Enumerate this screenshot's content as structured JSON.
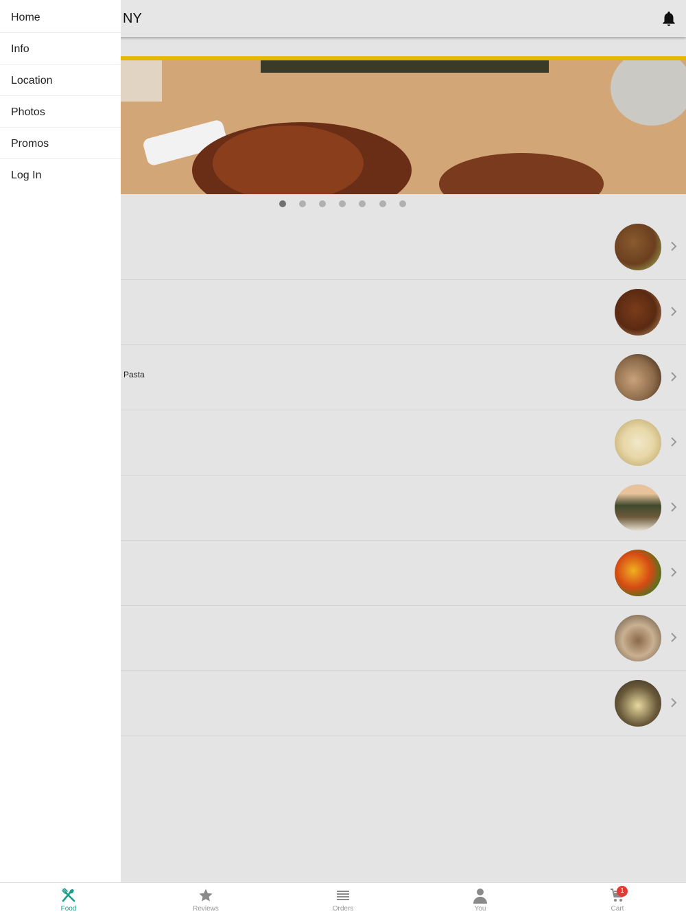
{
  "header": {
    "title": "NY",
    "bell_icon": "bell-icon"
  },
  "carousel": {
    "dot_count": 7,
    "active_index": 0
  },
  "menu": {
    "items": [
      {
        "label": "",
        "thumb_colors": [
          "#6b3f1f",
          "#8a5a2f",
          "#a8c060"
        ]
      },
      {
        "label": "",
        "thumb_colors": [
          "#5a2a12",
          "#7b3c1a",
          "#c9a070"
        ]
      },
      {
        "label": "e Pasta",
        "thumb_colors": [
          "#c9a27a",
          "#8c6a4a",
          "#2b1a10"
        ]
      },
      {
        "label": "",
        "thumb_colors": [
          "#e8d7a8",
          "#b7a060",
          "#f0e8c8"
        ]
      },
      {
        "label": "",
        "thumb_colors": [
          "#e8c29a",
          "#3f4a2c",
          "#6c5a3a"
        ]
      },
      {
        "label": "",
        "thumb_colors": [
          "#d64a14",
          "#f0b020",
          "#3a7a20"
        ]
      },
      {
        "label": "",
        "thumb_colors": [
          "#5a4a3c",
          "#c9b090",
          "#8a6a4a"
        ]
      },
      {
        "label": "",
        "thumb_colors": [
          "#2e2a22",
          "#e8d8a0",
          "#6a5a3a"
        ]
      }
    ]
  },
  "drawer": {
    "items": [
      {
        "label": "Home"
      },
      {
        "label": "Info"
      },
      {
        "label": "Location"
      },
      {
        "label": "Photos"
      },
      {
        "label": "Promos"
      },
      {
        "label": "Log In"
      }
    ]
  },
  "bottom_nav": {
    "items": [
      {
        "label": "Food",
        "icon": "utensils-icon",
        "active": true
      },
      {
        "label": "Reviews",
        "icon": "star-icon",
        "active": false
      },
      {
        "label": "Orders",
        "icon": "list-icon",
        "active": false
      },
      {
        "label": "You",
        "icon": "person-icon",
        "active": false
      },
      {
        "label": "Cart",
        "icon": "cart-icon",
        "active": false
      }
    ],
    "cart_badge": "1"
  },
  "colors": {
    "accent": "#1a9e86",
    "stripe": "#e8b500",
    "badge": "#e53935"
  }
}
